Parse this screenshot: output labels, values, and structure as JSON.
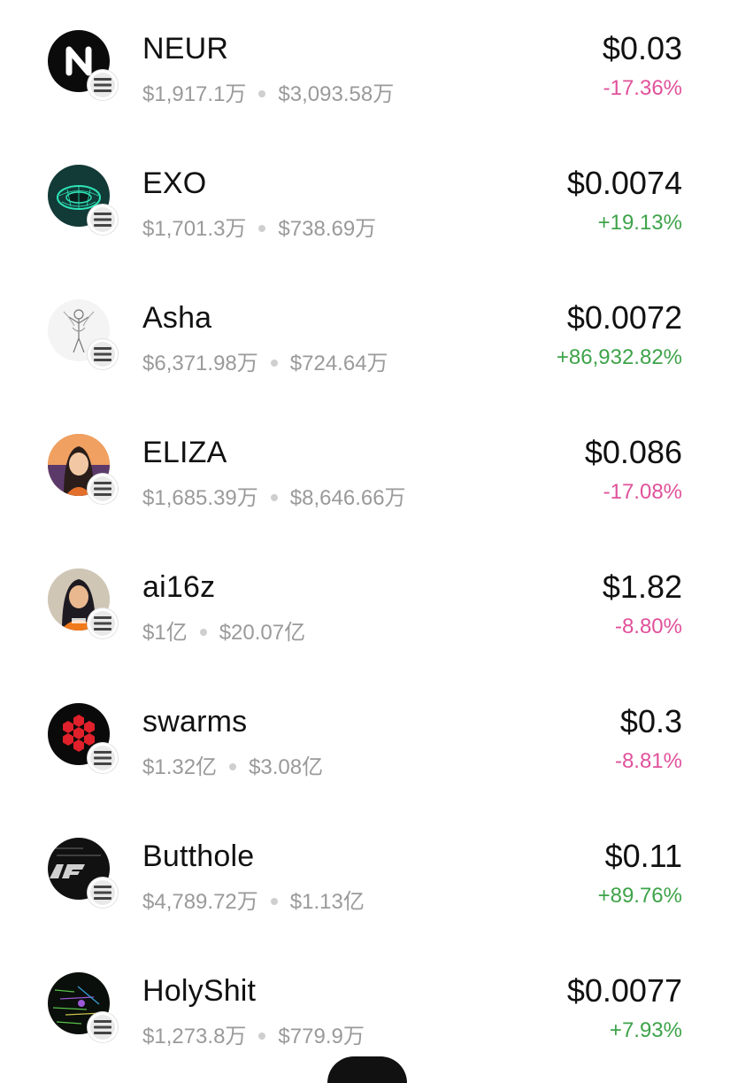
{
  "tokens": [
    {
      "name": "NEUR",
      "volume": "$1,917.1万",
      "market_cap": "$3,093.58万",
      "price": "$0.03",
      "change": "-17.36%",
      "direction": "neg",
      "icon": "neur-logo-icon"
    },
    {
      "name": "EXO",
      "volume": "$1,701.3万",
      "market_cap": "$738.69万",
      "price": "$0.0074",
      "change": "+19.13%",
      "direction": "pos",
      "icon": "exo-logo-icon"
    },
    {
      "name": "Asha",
      "volume": "$6,371.98万",
      "market_cap": "$724.64万",
      "price": "$0.0072",
      "change": "+86,932.82%",
      "direction": "pos",
      "icon": "asha-logo-icon"
    },
    {
      "name": "ELIZA",
      "volume": "$1,685.39万",
      "market_cap": "$8,646.66万",
      "price": "$0.086",
      "change": "-17.08%",
      "direction": "neg",
      "icon": "eliza-avatar-icon"
    },
    {
      "name": "ai16z",
      "volume": "$1亿",
      "market_cap": "$20.07亿",
      "price": "$1.82",
      "change": "-8.80%",
      "direction": "neg",
      "icon": "ai16z-avatar-icon"
    },
    {
      "name": "swarms",
      "volume": "$1.32亿",
      "market_cap": "$3.08亿",
      "price": "$0.3",
      "change": "-8.81%",
      "direction": "neg",
      "icon": "swarms-logo-icon"
    },
    {
      "name": "Butthole",
      "volume": "$4,789.72万",
      "market_cap": "$1.13亿",
      "price": "$0.11",
      "change": "+89.76%",
      "direction": "pos",
      "icon": "butthole-logo-icon"
    },
    {
      "name": "HolyShit",
      "volume": "$1,273.8万",
      "market_cap": "$779.9万",
      "price": "$0.0077",
      "change": "+7.93%",
      "direction": "pos",
      "icon": "holyshit-logo-icon"
    }
  ],
  "chain_badge_icon": "solana-icon",
  "colors": {
    "negative": "#e0519b",
    "positive": "#3ea34a",
    "text": "#111111",
    "muted": "#9a9a9a"
  }
}
